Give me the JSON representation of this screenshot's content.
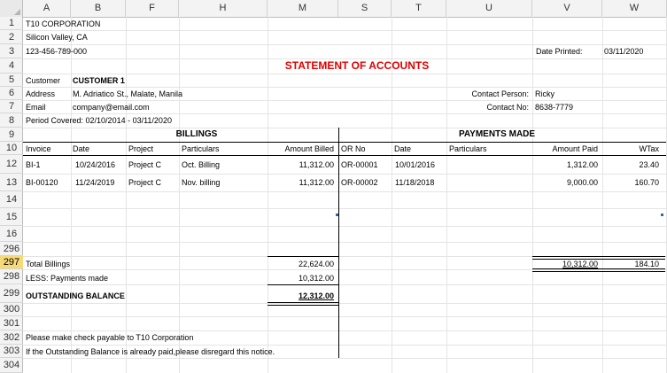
{
  "columns": [
    "A",
    "B",
    "F",
    "H",
    "M",
    "S",
    "T",
    "U",
    "V",
    "W"
  ],
  "rows": [
    "1",
    "2",
    "3",
    "4",
    "5",
    "6",
    "7",
    "8",
    "9",
    "10",
    "12",
    "13",
    "14",
    "15",
    "16",
    "296",
    "297",
    "298",
    "299",
    "300",
    "301",
    "302",
    "303",
    "304"
  ],
  "selected_row": "297",
  "company": {
    "name": "T10 CORPORATION",
    "location": "Silicon Valley, CA",
    "phone": "123-456-789-000"
  },
  "date_printed_label": "Date Printed:",
  "date_printed": "03/11/2020",
  "title": "STATEMENT OF ACCOUNTS",
  "customer_label": "Customer",
  "customer": "CUSTOMER 1",
  "address_label": "Address",
  "address": "M. Adriatico St., Malate, Manila",
  "email_label": "Email",
  "email": "company@email.com",
  "period": "Period Covered: 02/10/2014 - 03/11/2020",
  "contact_person_label": "Contact Person:",
  "contact_person": "Ricky",
  "contact_no_label": "Contact No:",
  "contact_no": "8638-7779",
  "billings_header": "BILLINGS",
  "payments_header": "PAYMENTS MADE",
  "table_headers": {
    "invoice": "Invoice",
    "date": "Date",
    "project": "Project",
    "particulars": "Particulars",
    "amount_billed": "Amount Billed",
    "or_no": "OR No",
    "pay_date": "Date",
    "pay_particulars": "Particulars",
    "amount_paid": "Amount Paid",
    "wtax": "WTax"
  },
  "entries": [
    {
      "invoice": "BI-1",
      "date": "10/24/2016",
      "project": "Project C",
      "particulars": "Oct. Billing",
      "amount_billed": "11,312.00",
      "or_no": "OR-00001",
      "pay_date": "10/01/2016",
      "amount_paid": "1,312.00",
      "wtax": "23.40"
    },
    {
      "invoice": "BI-00120",
      "date": "11/24/2019",
      "project": "Project C",
      "particulars": "Nov. billing",
      "amount_billed": "11,312.00",
      "or_no": "OR-00002",
      "pay_date": "11/18/2018",
      "amount_paid": "9,000.00",
      "wtax": "160.70"
    }
  ],
  "totals": {
    "total_billings_label": "Total Billings",
    "total_billings": "22,624.00",
    "less_label": "LESS: Payments made",
    "less_value": "10,312.00",
    "outstanding_label": "OUTSTANDING BALANCE",
    "outstanding": "12,312.00",
    "total_paid": "10,312.00",
    "total_wtax": "184.10"
  },
  "notes": [
    "Please make check payable to T10 Corporation",
    "If the Outstanding Balance is already paid,please disregard this notice."
  ],
  "colors": {
    "title": "#e00000",
    "selected_row": "#f7d978",
    "grid": "#e4e4e4"
  }
}
